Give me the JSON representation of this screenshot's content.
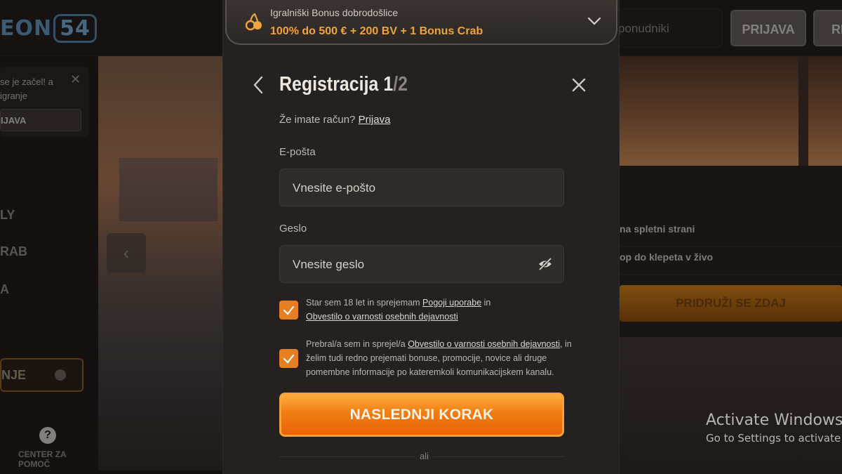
{
  "site": {
    "logo_text": "EON",
    "logo_num": "54",
    "search_placeholder": "ponudniki",
    "login_label": "PRIJAVA",
    "register_label": "RE"
  },
  "sidebar": {
    "promo_text": "se je začel! a igranje",
    "promo_button": "IJAVA",
    "items": [
      "LY",
      "RAB",
      "A"
    ],
    "promo_item": "NJE",
    "help_label": "CENTER ZA POMOČ"
  },
  "right_panel": {
    "rows": [
      "na spletni strani",
      "op do klepeta v živo"
    ],
    "join_label": "PRIDRUŽI SE ZDAJ"
  },
  "watermark": {
    "line1": "Activate Windows",
    "line2": "Go to Settings to activate W"
  },
  "modal": {
    "bonus": {
      "title": "Igralniški Bonus dobrodošlice",
      "value": "100% do 500 € + 200 BV + 1 Bonus Crab"
    },
    "title": "Registracija 1",
    "step": "/2",
    "have_account_text": "Že imate račun?",
    "have_account_link": "Prijava",
    "email_label": "E-pošta",
    "email_placeholder": "Vnesite e-pošto",
    "password_label": "Geslo",
    "password_placeholder": "Vnesite geslo",
    "consent1": {
      "a": "Star sem 18 let in sprejemam ",
      "link1": "Pogoji uporabe",
      "b": " in",
      "link2": "Obvestilo o varnosti osebnih dejavnosti",
      "checked": true
    },
    "consent2": {
      "a": "Prebral/a sem in sprejel/a ",
      "link1": "Obvestilo o varnosti osebnih dejavnosti",
      "b": ", in",
      "line2": "želim tudi redno prejemati bonuse, promocije, novice ali druge",
      "line3": "pomembne informacije po kateremkoli komunikacijskem kanalu.",
      "checked": true
    },
    "next_button": "NASLEDNJI KORAK",
    "or_text": "ali"
  },
  "colors": {
    "accent": "#f07d12",
    "bonus_text": "#f0a43a",
    "modal_bg": "#252120"
  },
  "icons": [
    "cherry-icon",
    "chevron-down-icon",
    "back-arrow-icon",
    "close-icon",
    "eye-off-icon",
    "checkmark-icon",
    "help-icon"
  ]
}
